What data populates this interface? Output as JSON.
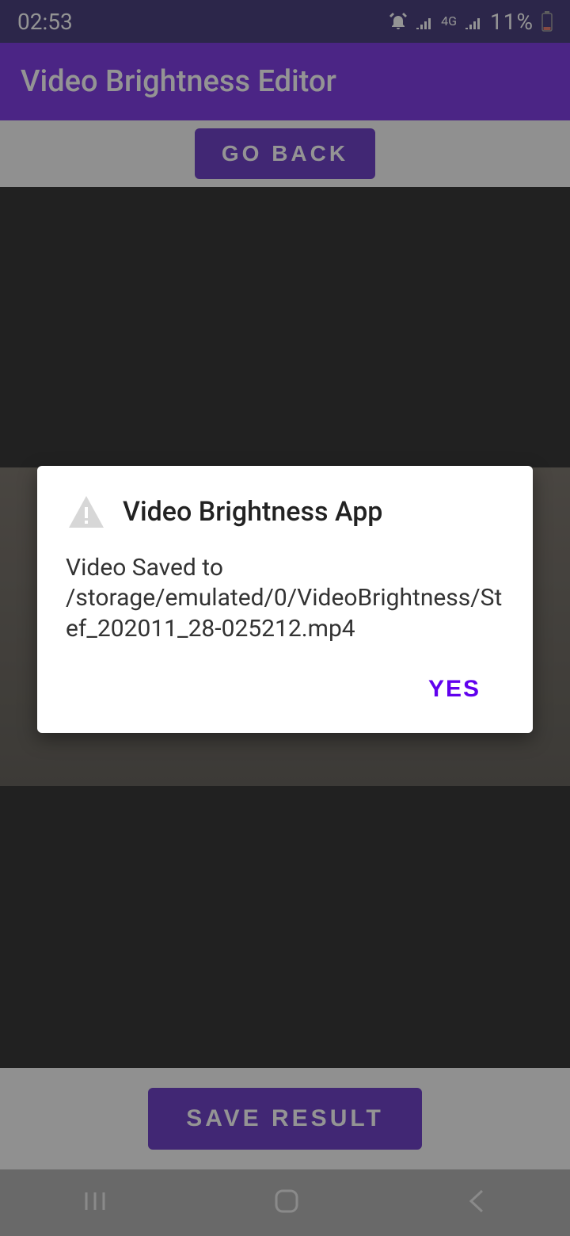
{
  "status": {
    "time": "02:53",
    "network_label": "4G",
    "battery_pct": "11%"
  },
  "appbar": {
    "title": "Video Brightness Editor"
  },
  "buttons": {
    "go_back": "GO BACK",
    "save_result": "SAVE RESULT",
    "yes": "YES"
  },
  "dialog": {
    "title": "Video Brightness App",
    "body": "Video Saved to\n /storage/emulated/0/VideoBrightness/Stef_202011_28-025212.mp4"
  }
}
